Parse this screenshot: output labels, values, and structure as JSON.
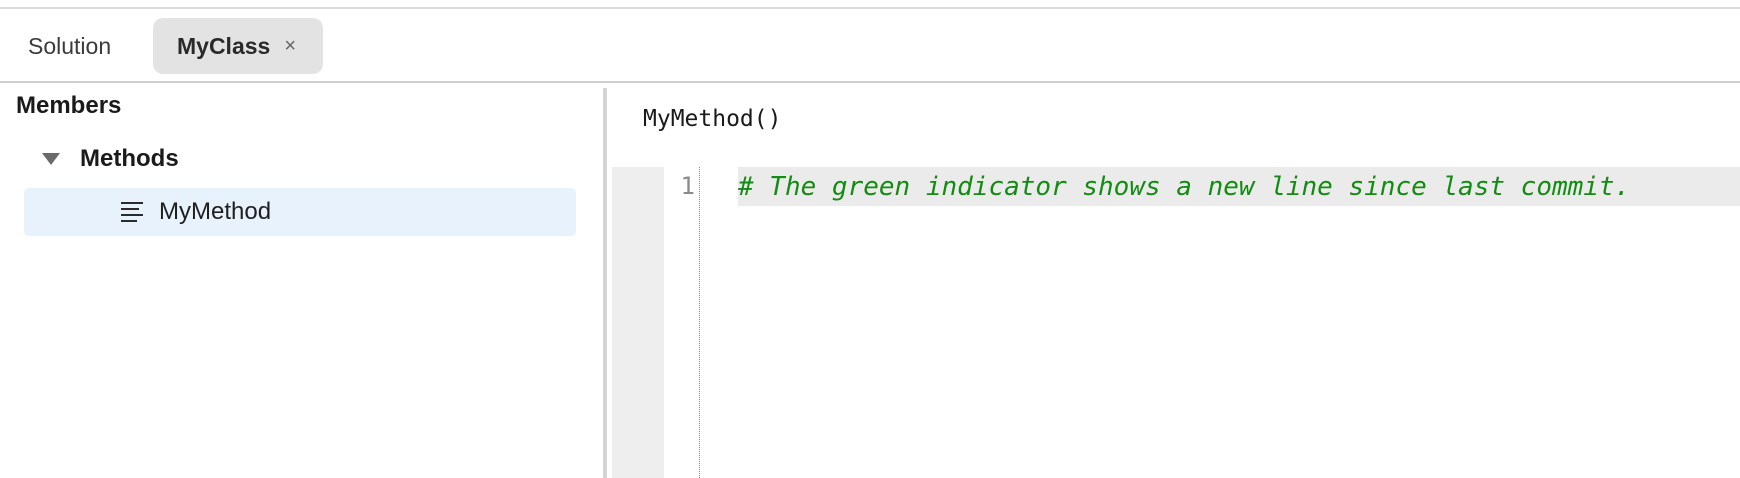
{
  "tabs": [
    {
      "label": "Solution",
      "active": false
    },
    {
      "label": "MyClass",
      "active": true,
      "close": "×"
    }
  ],
  "members_panel": {
    "title": "Members",
    "groups": [
      {
        "label": "Methods",
        "expanded": true,
        "icon": "triangle-down-icon",
        "items": [
          {
            "label": "MyMethod",
            "icon": "lines-icon",
            "selected": true
          }
        ]
      }
    ]
  },
  "editor": {
    "signature": "MyMethod()",
    "lines": [
      {
        "number": "1",
        "text": "# The green indicator shows a new line since last commit.",
        "status": "new"
      }
    ],
    "colors": {
      "comment": "#148c14",
      "selection": "#e8f2fd"
    }
  }
}
